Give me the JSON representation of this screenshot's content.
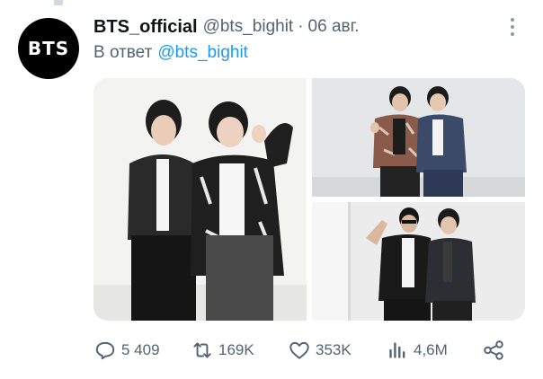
{
  "tweet": {
    "avatar_text": "BTS",
    "display_name": "BTS_official",
    "handle": "@bts_bighit",
    "separator": "·",
    "date": "06 авг.",
    "reply_prefix": "В ответ",
    "reply_to": "@bts_bighit"
  },
  "actions": {
    "replies": "5 409",
    "retweets": "169K",
    "likes": "353K",
    "views": "4,6M"
  },
  "icons": {
    "more": "more-dots-vertical-icon",
    "reply": "reply-bubble-icon",
    "retweet": "retweet-icon",
    "like": "heart-icon",
    "views": "bar-chart-icon",
    "share": "share-icon"
  },
  "colors": {
    "text_primary": "#0f1419",
    "text_secondary": "#536471",
    "link": "#1d9bf0",
    "avatar_bg": "#000000"
  }
}
